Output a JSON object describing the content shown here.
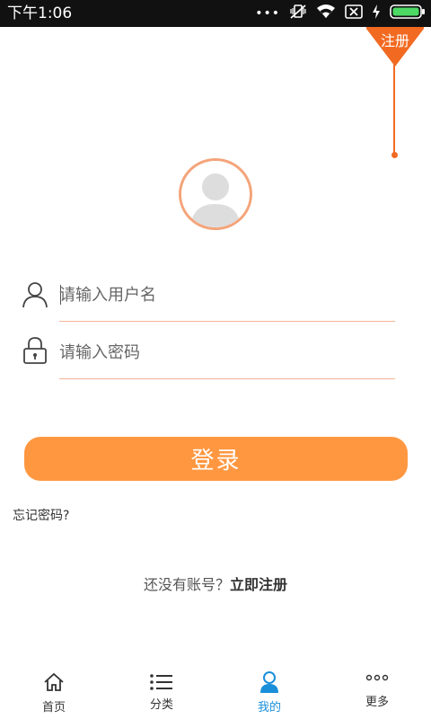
{
  "status_bar": {
    "time": "下午1:06",
    "icons": [
      "more-dots-icon",
      "vibrate-off-icon",
      "wifi-icon",
      "no-sim-icon",
      "charging-icon",
      "battery-icon"
    ]
  },
  "register_corner": {
    "label": "注册"
  },
  "avatar": {
    "icon": "default-avatar-icon"
  },
  "form": {
    "username": {
      "placeholder": "请输入用户名",
      "icon": "user-icon"
    },
    "password": {
      "placeholder": "请输入密码",
      "icon": "lock-icon"
    },
    "login_label": "登录",
    "forgot_label": "忘记密码?"
  },
  "signup": {
    "prompt": "还没有账号？",
    "link": "立即注册"
  },
  "bottom_nav": {
    "active": "mine",
    "items": [
      {
        "id": "home",
        "label": "首页",
        "icon": "home-icon"
      },
      {
        "id": "category",
        "label": "分类",
        "icon": "list-icon"
      },
      {
        "id": "mine",
        "label": "我的",
        "icon": "person-icon"
      },
      {
        "id": "more",
        "label": "更多",
        "icon": "more-icon"
      }
    ]
  },
  "colors": {
    "accent": "#ff9740",
    "ribbon": "#f26a21",
    "active_nav": "#1a8fd9",
    "field_line": "#f5b497"
  }
}
